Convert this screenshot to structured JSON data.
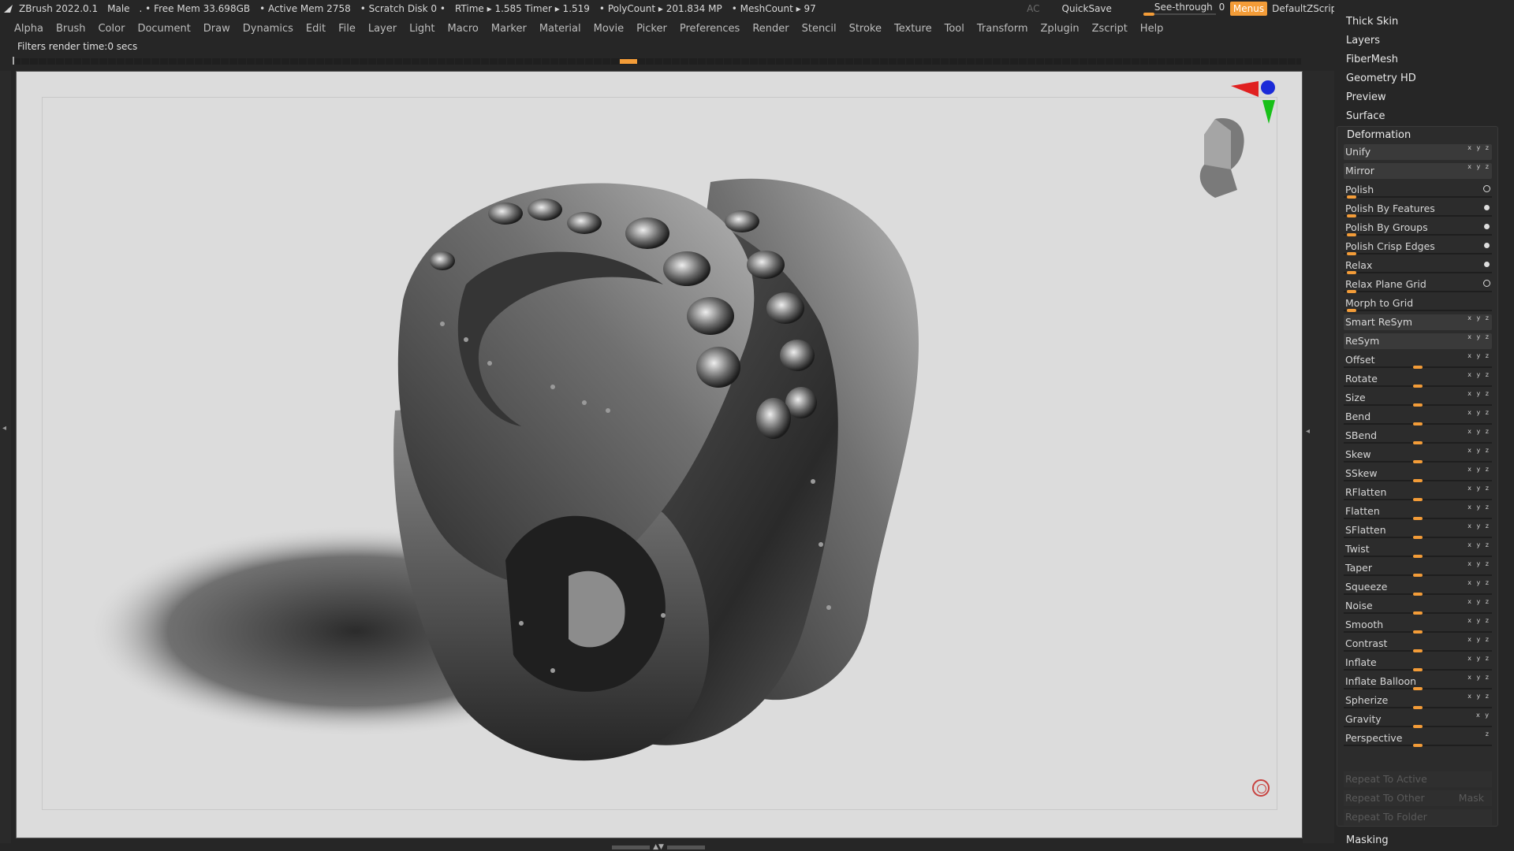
{
  "title_bar": {
    "app": "ZBrush 2022.0.1",
    "model": "Male",
    "free_mem": ". • Free Mem 33.698GB",
    "active_mem": "• Active Mem 2758",
    "scratch": "• Scratch Disk 0 •",
    "rtime": "RTime ▸ 1.585 Timer ▸ 1.519",
    "polycount": "• PolyCount ▸ 201.834 MP",
    "meshcount": "• MeshCount ▸ 97",
    "ac": "AC",
    "quicksave": "QuickSave",
    "see_through_label": "See-through",
    "see_through_value": "0",
    "see_through_level": 0,
    "menus": "Menus",
    "script": "DefaultZScript",
    "accent_color": "#f39c38"
  },
  "menu": [
    "Alpha",
    "Brush",
    "Color",
    "Document",
    "Draw",
    "Dynamics",
    "Edit",
    "File",
    "Layer",
    "Light",
    "Macro",
    "Marker",
    "Material",
    "Movie",
    "Picker",
    "Preferences",
    "Render",
    "Stencil",
    "Stroke",
    "Texture",
    "Tool",
    "Transform",
    "Zplugin",
    "Zscript",
    "Help"
  ],
  "status": "Filters render time:0 secs",
  "panel": {
    "top_items": [
      "Thick Skin",
      "Layers",
      "FiberMesh",
      "Geometry HD",
      "Preview",
      "Surface"
    ],
    "section": "Deformation",
    "rows": [
      {
        "name": "Unify",
        "kind": "button",
        "axes": "x y z"
      },
      {
        "name": "Mirror",
        "kind": "button",
        "axes": "x y z"
      },
      {
        "name": "Polish",
        "kind": "slider",
        "level": 0.02,
        "indicator": "ring"
      },
      {
        "name": "Polish By Features",
        "kind": "slider",
        "level": 0.02,
        "indicator": "dot"
      },
      {
        "name": "Polish By Groups",
        "kind": "slider",
        "level": 0.02,
        "indicator": "dot"
      },
      {
        "name": "Polish Crisp Edges",
        "kind": "slider",
        "level": 0.02,
        "indicator": "dot"
      },
      {
        "name": "Relax",
        "kind": "slider",
        "level": 0.02,
        "indicator": "dot"
      },
      {
        "name": "Relax Plane Grid",
        "kind": "slider",
        "level": 0.02,
        "indicator": "ring"
      },
      {
        "name": "Morph to Grid",
        "kind": "slider",
        "level": 0.02
      },
      {
        "name": "Smart ReSym",
        "kind": "button",
        "axes": "x y z"
      },
      {
        "name": "ReSym",
        "kind": "button",
        "axes": "x y z"
      },
      {
        "name": "Offset",
        "kind": "slider",
        "level": 0.5,
        "axes": "x y z"
      },
      {
        "name": "Rotate",
        "kind": "slider",
        "level": 0.5,
        "axes": "x y z"
      },
      {
        "name": "Size",
        "kind": "slider",
        "level": 0.5,
        "axes": "x y z"
      },
      {
        "name": "Bend",
        "kind": "slider",
        "level": 0.5,
        "axes": "x y z"
      },
      {
        "name": "SBend",
        "kind": "slider",
        "level": 0.5,
        "axes": "x y z"
      },
      {
        "name": "Skew",
        "kind": "slider",
        "level": 0.5,
        "axes": "x y z"
      },
      {
        "name": "SSkew",
        "kind": "slider",
        "level": 0.5,
        "axes": "x y z"
      },
      {
        "name": "RFlatten",
        "kind": "slider",
        "level": 0.5,
        "axes": "x y z"
      },
      {
        "name": "Flatten",
        "kind": "slider",
        "level": 0.5,
        "axes": "x y z"
      },
      {
        "name": "SFlatten",
        "kind": "slider",
        "level": 0.5,
        "axes": "x y z"
      },
      {
        "name": "Twist",
        "kind": "slider",
        "level": 0.5,
        "axes": "x y z"
      },
      {
        "name": "Taper",
        "kind": "slider",
        "level": 0.5,
        "axes": "x y z"
      },
      {
        "name": "Squeeze",
        "kind": "slider",
        "level": 0.5,
        "axes": "x y z"
      },
      {
        "name": "Noise",
        "kind": "slider",
        "level": 0.5,
        "axes": "x y z"
      },
      {
        "name": "Smooth",
        "kind": "slider",
        "level": 0.5,
        "axes": "x y z"
      },
      {
        "name": "Contrast",
        "kind": "slider",
        "level": 0.5,
        "axes": "x y z"
      },
      {
        "name": "Inflate",
        "kind": "slider",
        "level": 0.5,
        "axes": "x y z"
      },
      {
        "name": "Inflate Balloon",
        "kind": "slider",
        "level": 0.5,
        "axes": "x y z"
      },
      {
        "name": "Spherize",
        "kind": "slider",
        "level": 0.5,
        "axes": "x y z"
      },
      {
        "name": "Gravity",
        "kind": "slider",
        "level": 0.5,
        "axes": "x y"
      },
      {
        "name": "Perspective",
        "kind": "slider",
        "level": 0.5,
        "axes": "z"
      }
    ],
    "disabled": [
      {
        "name": "Repeat To Active"
      },
      {
        "name": "Repeat To Other",
        "extra": "Mask"
      },
      {
        "name": "Repeat To Folder"
      }
    ],
    "bottom_item": "Masking"
  }
}
